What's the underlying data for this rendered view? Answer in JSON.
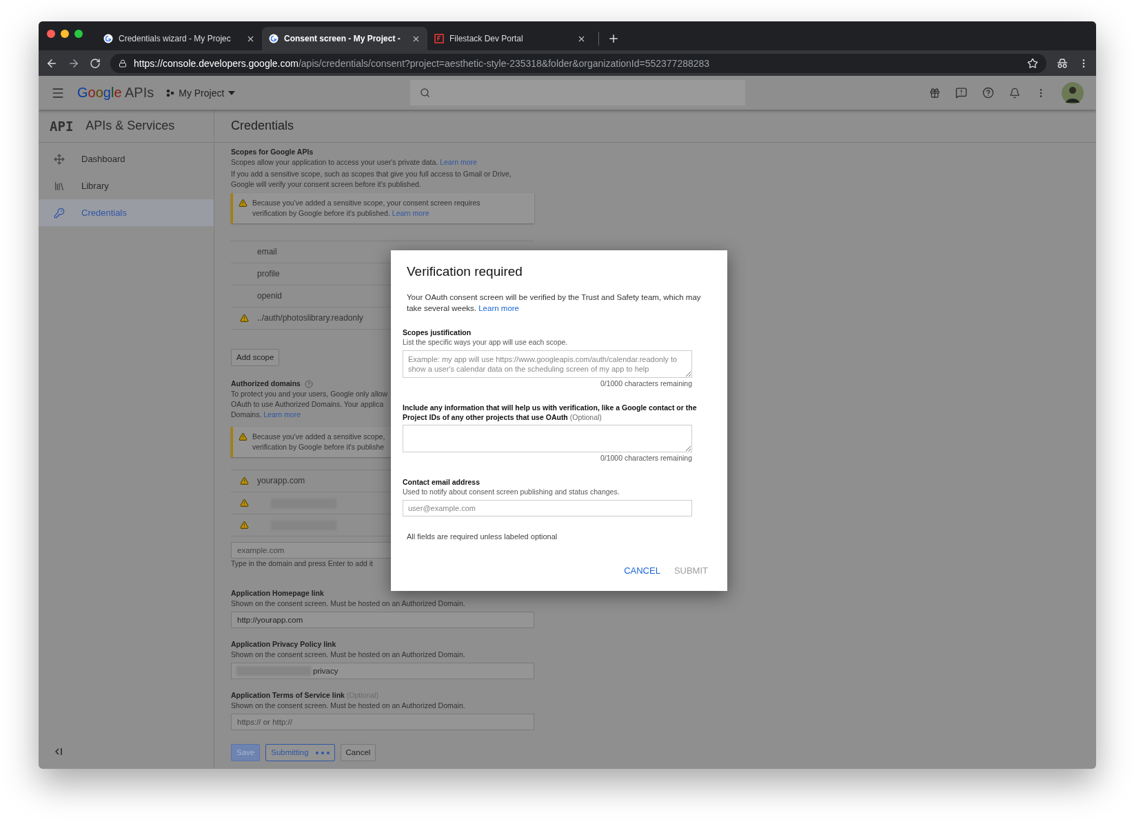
{
  "browser": {
    "tabs": [
      {
        "title": "Credentials wizard - My Projec",
        "selected": false,
        "kind": "google"
      },
      {
        "title": "Consent screen - My Project -",
        "selected": true,
        "kind": "google"
      },
      {
        "title": "Filestack Dev Portal",
        "selected": false,
        "kind": "filestack"
      }
    ],
    "url": {
      "host": "https://console.developers.google.com",
      "path": "/apis/credentials/consent?project=aesthetic-style-235318&folder&organizationId=552377288283"
    }
  },
  "header": {
    "logo": "Google",
    "product": "APIs",
    "project": "My Project"
  },
  "sidebar": {
    "badge": "API",
    "title": "APIs & Services",
    "items": [
      {
        "label": "Dashboard",
        "kind": "dashboard",
        "selected": false
      },
      {
        "label": "Library",
        "kind": "library",
        "selected": false
      },
      {
        "label": "Credentials",
        "kind": "credentials",
        "selected": true
      }
    ]
  },
  "page": {
    "title": "Credentials",
    "scopes": {
      "heading": "Scopes for Google APIs",
      "intro": "Scopes allow your application to access your user's private data.",
      "intro_link": "Learn more",
      "note": "If you add a sensitive scope, such as scopes that give you full access to Gmail or Drive, Google will verify your consent screen before it's published.",
      "warning": {
        "lines": [
          "Because you've added a sensitive scope, your consent screen requires",
          "verification by Google before it's published."
        ],
        "link": "Learn more"
      },
      "items": [
        {
          "name": "email",
          "warning": false
        },
        {
          "name": "profile",
          "warning": false
        },
        {
          "name": "openid",
          "warning": false
        },
        {
          "name": "../auth/photoslibrary.readonly",
          "warning": true
        }
      ],
      "add_button": "Add scope"
    },
    "domains": {
      "heading": "Authorized domains",
      "lines": [
        "To protect you and your users, Google only allow",
        "OAuth to use Authorized Domains. Your applica",
        "Domains."
      ],
      "link": "Learn more",
      "warning": {
        "lines": [
          "Because you've added a sensitive scope,",
          "verification by Google before it's publishe"
        ]
      },
      "items": [
        {
          "kind": "text",
          "name": "yourapp.com",
          "warning": true
        },
        {
          "kind": "redacted",
          "warning": true
        },
        {
          "kind": "redacted",
          "warning": true
        }
      ],
      "placeholder": "example.com",
      "hint": "Type in the domain and press Enter to add it"
    },
    "fields": [
      {
        "label": "Application Homepage link",
        "hint": "Shown on the consent screen. Must be hosted on an Authorized Domain.",
        "value": "http://yourapp.com",
        "redacted_prefix": false
      },
      {
        "label": "Application Privacy Policy link",
        "hint": "Shown on the consent screen. Must be hosted on an Authorized Domain.",
        "value": "privacy",
        "redacted_prefix": true
      },
      {
        "label": "Application Terms of Service link",
        "optional": "(Optional)",
        "hint": "Shown on the consent screen. Must be hosted on an Authorized Domain.",
        "placeholder": "https:// or http://",
        "redacted_prefix": false
      }
    ],
    "buttons": [
      {
        "label": "Save",
        "kind": "primary",
        "disabled": true
      },
      {
        "label": "Submitting",
        "kind": "progress",
        "disabled": false
      },
      {
        "label": "Cancel",
        "kind": "plain",
        "disabled": false
      }
    ]
  },
  "dialog": {
    "title": "Verification required",
    "body": "Your OAuth consent screen will be verified by the Trust and Safety team, which may take several weeks.",
    "body_link": "Learn more",
    "sections": [
      {
        "kind": "textarea",
        "label": "Scopes justification",
        "hint": "List the specific ways your app will use each scope.",
        "placeholder": "Example: my app will use https://www.googleapis.com/auth/calendar.readonly to show a user's calendar data on the scheduling screen of my app to help",
        "counter": "0/1000 characters remaining"
      },
      {
        "kind": "textarea",
        "label": "Include any information that will help us with verification, like a Google contact or the Project IDs of any other projects that use OAuth",
        "optional": "(Optional)",
        "counter": "0/1000 characters remaining"
      },
      {
        "kind": "input",
        "label": "Contact email address",
        "hint": "Used to notify about consent screen publishing and status changes.",
        "placeholder": "user@example.com"
      }
    ],
    "note": "All fields are required unless labeled optional",
    "actions": [
      {
        "label": "CANCEL",
        "disabled": false
      },
      {
        "label": "SUBMIT",
        "disabled": true
      }
    ]
  }
}
